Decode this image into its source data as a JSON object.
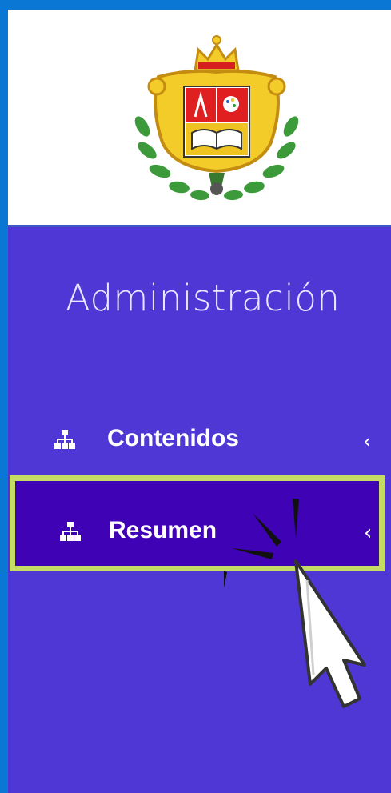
{
  "sidebar": {
    "logo": "institution-crest-logo",
    "section_title": "Administración",
    "items": [
      {
        "label": "Contenidos",
        "icon": "sitemap-icon",
        "chevron": "‹",
        "active": false
      },
      {
        "label": "Resumen",
        "icon": "sitemap-icon",
        "chevron": "‹",
        "active": true
      }
    ]
  },
  "colors": {
    "page_background": "#0b77d4",
    "sidebar_background": "#4f37d6",
    "active_item_background": "#3f02b4",
    "highlight_border": "#c4dc64",
    "text": "#ffffff"
  },
  "overlay": {
    "cursor": "pointer-cursor-icon",
    "click_effect": "click-burst-icon"
  }
}
